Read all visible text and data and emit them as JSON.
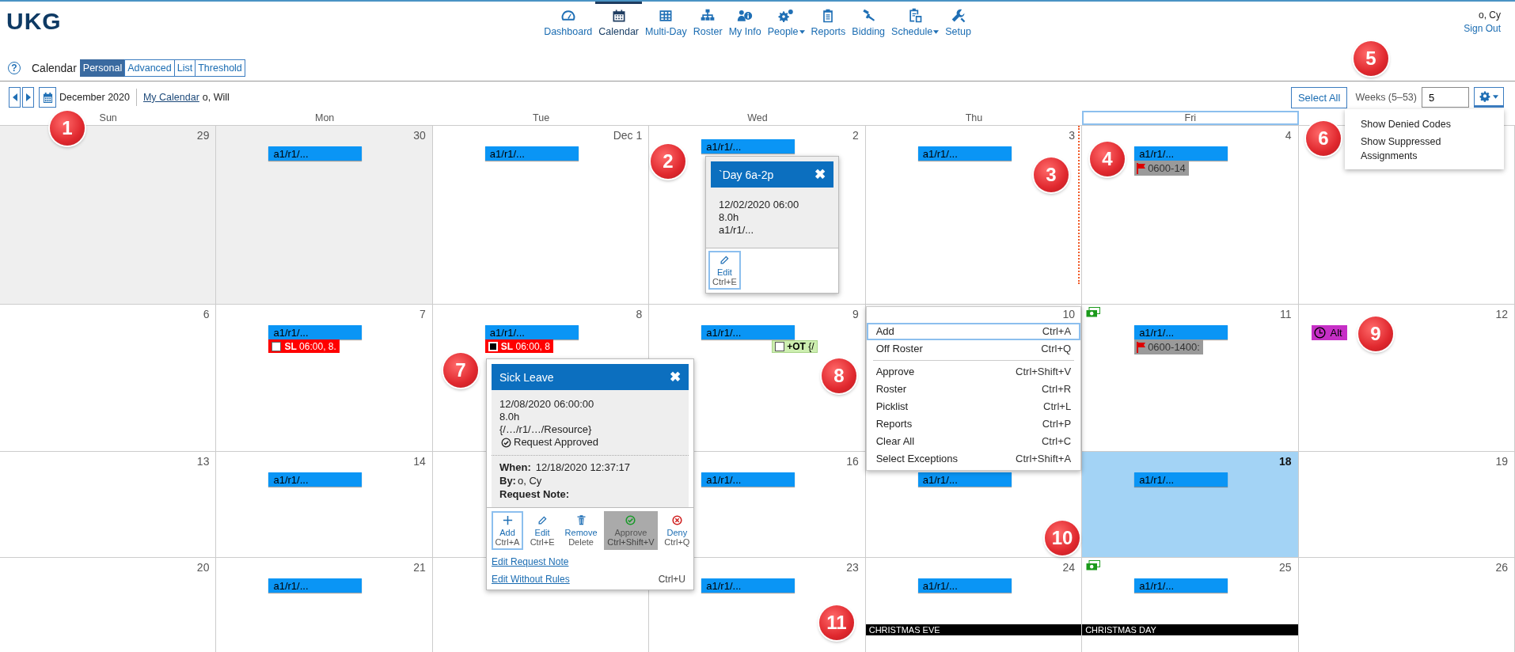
{
  "header": {
    "logo": "UKG",
    "user": "o, Cy",
    "sign_out": "Sign Out"
  },
  "nav": [
    {
      "label": "Dashboard",
      "selected": false,
      "dropdown": false
    },
    {
      "label": "Calendar",
      "selected": true,
      "dropdown": false
    },
    {
      "label": "Multi-Day",
      "selected": false,
      "dropdown": false
    },
    {
      "label": "Roster",
      "selected": false,
      "dropdown": false
    },
    {
      "label": "My Info",
      "selected": false,
      "dropdown": false
    },
    {
      "label": "People",
      "selected": false,
      "dropdown": true
    },
    {
      "label": "Reports",
      "selected": false,
      "dropdown": false
    },
    {
      "label": "Bidding",
      "selected": false,
      "dropdown": false
    },
    {
      "label": "Schedule",
      "selected": false,
      "dropdown": true
    },
    {
      "label": "Setup",
      "selected": false,
      "dropdown": false
    }
  ],
  "page": {
    "help": "?",
    "title": "Calendar",
    "tabs": [
      {
        "label": "Personal",
        "selected": true
      },
      {
        "label": "Advanced",
        "selected": false
      },
      {
        "label": "List",
        "selected": false
      },
      {
        "label": "Threshold",
        "selected": false
      }
    ]
  },
  "toolbar": {
    "month": "December 2020",
    "calendar_link": "My Calendar",
    "person": "o, Will",
    "select_all": "Select All",
    "weeks_label": "Weeks (5–53)",
    "weeks_value": "5"
  },
  "settings_menu": [
    "Show Denied Codes",
    "Show Suppressed Assignments"
  ],
  "days": [
    {
      "label": "Sun",
      "selected": false
    },
    {
      "label": "Mon",
      "selected": false
    },
    {
      "label": "Tue",
      "selected": false
    },
    {
      "label": "Wed",
      "selected": false
    },
    {
      "label": "Thu",
      "selected": false
    },
    {
      "label": "Fri",
      "selected": true
    }
  ],
  "weeks": [
    [
      {
        "day": "29",
        "muted": true,
        "selected": false
      },
      {
        "day": "30",
        "muted": true,
        "selected": false,
        "events": [
          {
            "kind": "shift",
            "label": "a1/r1/..."
          }
        ]
      },
      {
        "day": "Dec 1",
        "muted": false,
        "selected": false,
        "events": [
          {
            "kind": "shift",
            "label": "a1/r1/..."
          }
        ]
      },
      {
        "day": "2",
        "muted": false,
        "selected": false,
        "events": [
          {
            "kind": "shift",
            "label": "a1/r1/..."
          }
        ]
      },
      {
        "day": "3",
        "muted": false,
        "selected": false,
        "events": [
          {
            "kind": "shift",
            "label": "a1/r1/..."
          }
        ]
      },
      {
        "day": "4",
        "muted": false,
        "selected": false,
        "events": [
          {
            "kind": "shift",
            "label": "a1/r1/..."
          },
          {
            "kind": "flag",
            "label": "0600-14"
          }
        ]
      },
      {
        "muted": false,
        "selected": false
      }
    ],
    [
      {
        "day": "6",
        "muted": false,
        "selected": false
      },
      {
        "day": "7",
        "muted": false,
        "selected": false,
        "events": [
          {
            "kind": "shift",
            "label": "a1/r1/..."
          },
          {
            "kind": "leave",
            "label": "**SL** 06:00, 8.",
            "checked": false
          }
        ]
      },
      {
        "day": "8",
        "muted": false,
        "selected": false,
        "events": [
          {
            "kind": "shift",
            "label": "a1/r1/..."
          },
          {
            "kind": "leave",
            "label": "**SL** 06:00, 8",
            "checked": true
          }
        ]
      },
      {
        "day": "9",
        "muted": false,
        "selected": false,
        "events": [
          {
            "kind": "shift",
            "label": "a1/r1/..."
          },
          {
            "kind": "overtime",
            "label": "**+OT** {/",
            "checked": false
          }
        ]
      },
      {
        "day": "10",
        "muted": false,
        "selected": false
      },
      {
        "day": "11",
        "muted": false,
        "selected": false,
        "events": [
          {
            "kind": "money"
          },
          {
            "kind": "shift",
            "label": "a1/r1/..."
          },
          {
            "kind": "flag",
            "label": "0600-1400:"
          }
        ]
      },
      {
        "day": "12",
        "muted": false,
        "selected": false,
        "events": [
          {
            "kind": "alternate",
            "label": "Alt"
          }
        ]
      }
    ],
    [
      {
        "day": "13",
        "muted": false,
        "selected": false
      },
      {
        "day": "14",
        "muted": false,
        "selected": false,
        "events": [
          {
            "kind": "shift",
            "label": "a1/r1/..."
          }
        ]
      },
      {
        "muted": false,
        "selected": false
      },
      {
        "day": "16",
        "muted": false,
        "selected": false,
        "events": [
          {
            "kind": "shift",
            "label": "a1/r1/..."
          }
        ]
      },
      {
        "muted": false,
        "selected": false,
        "events": [
          {
            "kind": "shift",
            "label": "a1/r1/..."
          }
        ]
      },
      {
        "day": "18",
        "muted": false,
        "selected": true,
        "events": [
          {
            "kind": "shift",
            "label": "a1/r1/..."
          }
        ]
      },
      {
        "day": "19",
        "muted": false,
        "selected": false
      }
    ],
    [
      {
        "day": "20",
        "muted": false,
        "selected": false
      },
      {
        "day": "21",
        "muted": false,
        "selected": false,
        "events": [
          {
            "kind": "shift",
            "label": "a1/r1/..."
          }
        ]
      },
      {
        "muted": false,
        "selected": false
      },
      {
        "day": "23",
        "muted": false,
        "selected": false,
        "events": [
          {
            "kind": "shift",
            "label": "a1/r1/..."
          }
        ]
      },
      {
        "day": "24",
        "muted": false,
        "selected": false,
        "events": [
          {
            "kind": "shift",
            "label": "a1/r1/..."
          },
          {
            "kind": "holiday",
            "label": "CHRISTMAS EVE"
          }
        ]
      },
      {
        "day": "25",
        "muted": false,
        "selected": false,
        "events": [
          {
            "kind": "money"
          },
          {
            "kind": "shift",
            "label": "a1/r1/..."
          },
          {
            "kind": "holiday",
            "label": "CHRISTMAS DAY"
          }
        ]
      },
      {
        "day": "26",
        "muted": false,
        "selected": false
      }
    ]
  ],
  "shift_popup": {
    "title": "`Day 6a-2p",
    "close": "✖",
    "lines": [
      "12/02/2020 06:00",
      "8.0h",
      "a1/r1/..."
    ],
    "action": {
      "label": "Edit",
      "shortcut": "Ctrl+E",
      "selected": true
    }
  },
  "leave_popup": {
    "title": "Sick Leave",
    "close": "✖",
    "lines": [
      "12/08/2020 06:00:00",
      "8.0h",
      "{/…/r1/…/Resource}"
    ],
    "status": "Request Approved",
    "when_label": "When:",
    "when": "12/18/2020 12:37:17",
    "by_label": "By:",
    "by": "o, Cy",
    "note_label": "Request Note:",
    "actions": [
      {
        "label": "Add",
        "shortcut": "Ctrl+A",
        "selected": true,
        "disabled": false
      },
      {
        "label": "Edit",
        "shortcut": "Ctrl+E",
        "selected": false,
        "disabled": false
      },
      {
        "label": "Remove",
        "shortcut": "Delete",
        "selected": false,
        "disabled": false
      },
      {
        "label": "Approve",
        "shortcut": "Ctrl+Shift+V",
        "selected": false,
        "disabled": true
      },
      {
        "label": "Deny",
        "shortcut": "Ctrl+Q",
        "selected": false,
        "disabled": false
      }
    ],
    "links": [
      {
        "label": "Edit Request Note"
      },
      {
        "label": "Edit Without Rules",
        "shortcut": "Ctrl+U"
      }
    ]
  },
  "context_menu": {
    "groups": [
      [
        {
          "label": "Add",
          "shortcut": "Ctrl+A",
          "selected": true
        },
        {
          "label": "Off Roster",
          "shortcut": "Ctrl+Q",
          "selected": false
        }
      ],
      [
        {
          "label": "Approve",
          "shortcut": "Ctrl+Shift+V",
          "selected": false
        },
        {
          "label": "Roster",
          "shortcut": "Ctrl+R",
          "selected": false
        },
        {
          "label": "Picklist",
          "shortcut": "Ctrl+L",
          "selected": false
        },
        {
          "label": "Reports",
          "shortcut": "Ctrl+P",
          "selected": false
        },
        {
          "label": "Clear All",
          "shortcut": "Ctrl+C",
          "selected": false
        },
        {
          "label": "Select Exceptions",
          "shortcut": "Ctrl+Shift+A",
          "selected": false
        }
      ]
    ]
  },
  "markers": [
    "1",
    "2",
    "3",
    "4",
    "5",
    "6",
    "7",
    "8",
    "9",
    "10",
    "11"
  ]
}
